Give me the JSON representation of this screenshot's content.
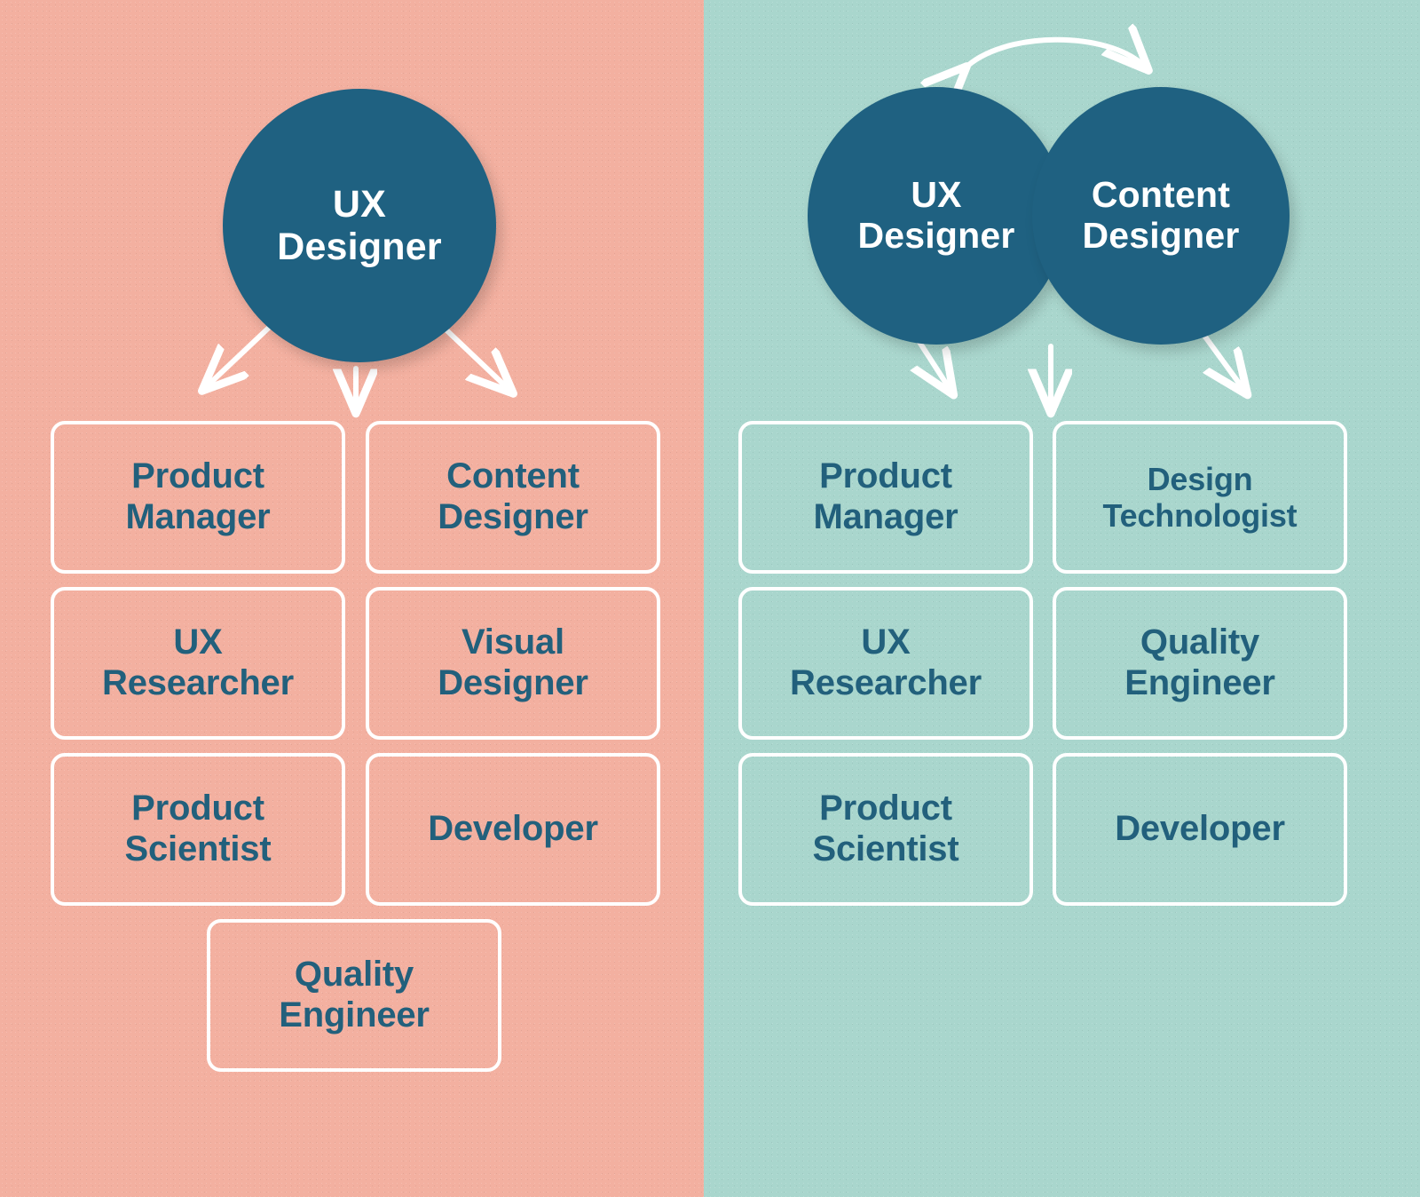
{
  "colors": {
    "left_background": "#f3b0a0",
    "right_background": "#a9d6cd",
    "circle_fill": "#1f6181",
    "circle_text": "#ffffff",
    "card_border": "#ffffff",
    "card_text": "#22607c",
    "arrow": "#ffffff"
  },
  "left_panel": {
    "hub": {
      "line1": "UX",
      "line2": "Designer"
    },
    "arrows": [
      {
        "name": "arrow-hub-to-left",
        "direction": "down-left"
      },
      {
        "name": "arrow-hub-to-center",
        "direction": "down"
      },
      {
        "name": "arrow-hub-to-right",
        "direction": "down-right"
      }
    ],
    "cards": [
      {
        "line1": "Product",
        "line2": "Manager"
      },
      {
        "line1": "Content",
        "line2": "Designer"
      },
      {
        "line1": "UX",
        "line2": "Researcher"
      },
      {
        "line1": "Visual",
        "line2": "Designer"
      },
      {
        "line1": "Product",
        "line2": "Scientist"
      },
      {
        "line1": "Developer",
        "line2": ""
      },
      {
        "line1": "Quality",
        "line2": "Engineer"
      }
    ]
  },
  "right_panel": {
    "hub_left": {
      "line1": "UX",
      "line2": "Designer"
    },
    "hub_right": {
      "line1": "Content",
      "line2": "Designer"
    },
    "pair_arrow": {
      "name": "double-headed-curved-arrow",
      "direction": "bidirectional"
    },
    "arrows": [
      {
        "name": "arrow-hub-to-left",
        "direction": "down-left"
      },
      {
        "name": "arrow-hub-to-center",
        "direction": "down"
      },
      {
        "name": "arrow-hub-to-right",
        "direction": "down-right"
      }
    ],
    "cards": [
      {
        "line1": "Product",
        "line2": "Manager"
      },
      {
        "line1": "Design",
        "line2": "Technologist"
      },
      {
        "line1": "UX",
        "line2": "Researcher"
      },
      {
        "line1": "Quality",
        "line2": "Engineer"
      },
      {
        "line1": "Product",
        "line2": "Scientist"
      },
      {
        "line1": "Developer",
        "line2": ""
      }
    ]
  }
}
